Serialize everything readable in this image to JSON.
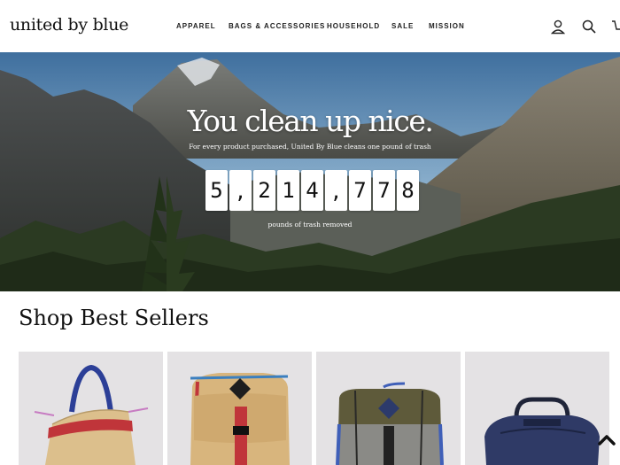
{
  "brand": {
    "logo_text": "united by blue"
  },
  "nav": {
    "items": [
      {
        "id": "apparel",
        "label": "APPAREL"
      },
      {
        "id": "bags",
        "label": "BAGS & ACCESSORIES"
      },
      {
        "id": "household",
        "label": "HOUSEHOLD"
      },
      {
        "id": "sale",
        "label": "SALE"
      },
      {
        "id": "mission",
        "label": "MISSION"
      }
    ]
  },
  "header_icons": [
    "account-icon",
    "search-icon",
    "cart-icon"
  ],
  "hero": {
    "title": "You clean up nice.",
    "subtitle": "For every product purchased, United By Blue cleans one pound of trash",
    "counter_digits": [
      "5",
      ",",
      "2",
      "1",
      "4",
      ",",
      "7",
      "7",
      "8"
    ],
    "caption": "pounds of trash removed"
  },
  "best_sellers": {
    "title": "Shop Best Sellers",
    "products": [
      {
        "id": "tote",
        "icon": "tote-bag-image"
      },
      {
        "id": "rucksack",
        "icon": "rucksack-image"
      },
      {
        "id": "backpack",
        "icon": "backpack-image"
      },
      {
        "id": "duffel",
        "icon": "duffel-bag-image"
      }
    ]
  },
  "colors": {
    "accent_navy": "#2c3a6b",
    "tan": "#d9b37c",
    "olive": "#5e5a3a",
    "red": "#c0353a"
  }
}
